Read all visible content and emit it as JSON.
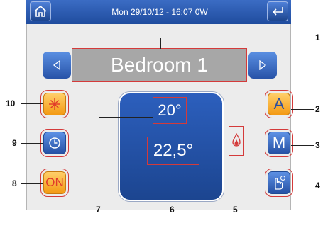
{
  "header": {
    "datetime_status": "Mon 29/10/12 - 16:07   0W"
  },
  "room": {
    "name": "Bedroom 1"
  },
  "temperatures": {
    "setpoint": "20°",
    "measured": "22,5°"
  },
  "buttons": {
    "auto_label": "A",
    "manual_label": "M",
    "on_label": "ON"
  },
  "callouts": [
    "1",
    "2",
    "3",
    "4",
    "5",
    "6",
    "7",
    "8",
    "9",
    "10"
  ],
  "colors": {
    "header_blue": "#1f4c9e",
    "button_orange": "#f39a14",
    "highlight_red": "#d43a3a"
  }
}
